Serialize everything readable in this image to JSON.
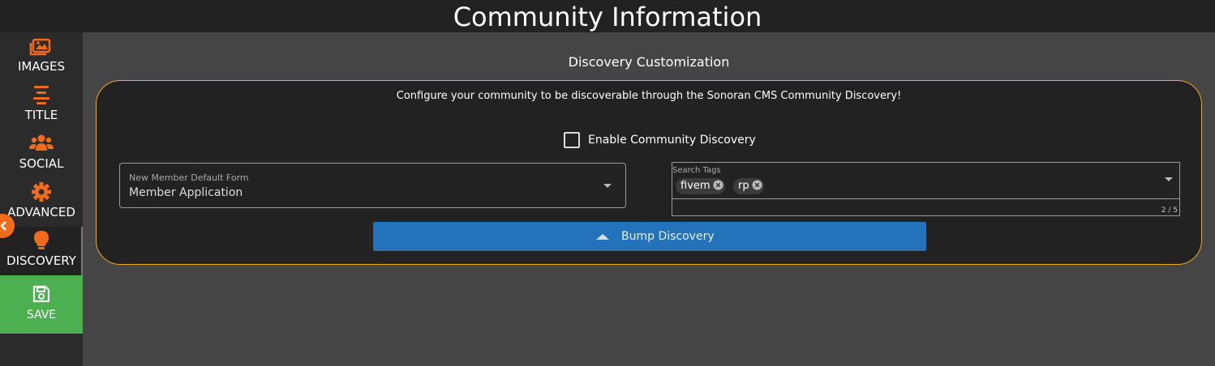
{
  "header": {
    "title": "Community Information"
  },
  "sidebar": {
    "items": [
      {
        "label": "IMAGES",
        "icon": "images-icon"
      },
      {
        "label": "TITLE",
        "icon": "align-center-icon"
      },
      {
        "label": "SOCIAL",
        "icon": "users-icon"
      },
      {
        "label": "ADVANCED",
        "icon": "gear-icon"
      },
      {
        "label": "DISCOVERY",
        "icon": "lightbulb-icon"
      }
    ],
    "active": "DISCOVERY",
    "save_label": "SAVE",
    "save_icon": "floppy-disk-icon",
    "collapse_icon": "chevron-left-icon"
  },
  "main": {
    "heading": "Discovery Customization",
    "description": "Configure your community to be discoverable through the Sonoran CMS Community Discovery!",
    "enable_discovery": {
      "label": "Enable Community Discovery",
      "checked": false
    },
    "default_form": {
      "label": "New Member Default Form",
      "value": "Member Application"
    },
    "search_tags": {
      "label": "Search Tags",
      "tags": [
        "fivem",
        "rp"
      ],
      "counter": "2 / 5"
    },
    "bump_button": {
      "label": "Bump Discovery"
    }
  },
  "colors": {
    "accent_orange": "#f26b1d",
    "card_border": "#f0a81c",
    "save_green": "#4caf50",
    "bump_blue": "#2472b9"
  }
}
